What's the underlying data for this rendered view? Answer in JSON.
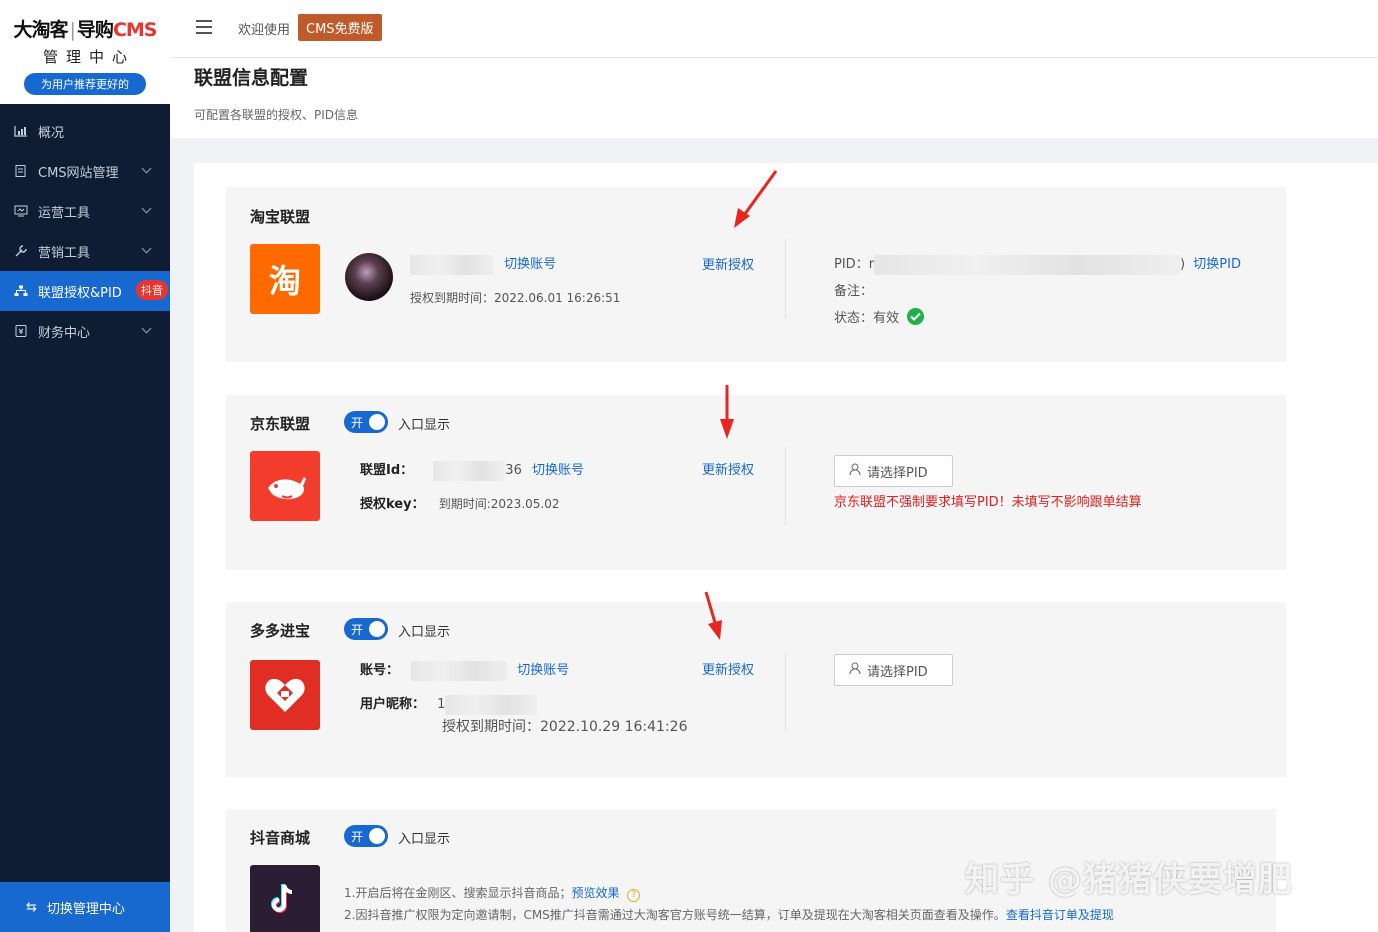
{
  "brand": {
    "logo_part1": "大淘客",
    "logo_sep": "|",
    "logo_part2": "导购",
    "logo_part3": "CMS",
    "subtitle": "管理中心",
    "slogan": "为用户推荐更好的"
  },
  "sidebar": {
    "items": [
      {
        "label": "概况",
        "icon": "bar-chart-icon"
      },
      {
        "label": "CMS网站管理",
        "icon": "document-icon"
      },
      {
        "label": "运营工具",
        "icon": "monitor-icon"
      },
      {
        "label": "营销工具",
        "icon": "wrench-icon"
      },
      {
        "label": "联盟授权&PID",
        "icon": "sitemap-icon",
        "badge": "抖音"
      },
      {
        "label": "财务中心",
        "icon": "finance-icon"
      }
    ],
    "footer_label": "切换管理中心"
  },
  "topbar": {
    "welcome": "欢迎使用",
    "version": "CMS免费版"
  },
  "page": {
    "title": "联盟信息配置",
    "description": "可配置各联盟的授权、PID信息"
  },
  "taobao": {
    "title": "淘宝联盟",
    "logo_char": "淘",
    "switch_account": "切换账号",
    "expire": "授权到期时间：2022.06.01 16:26:51",
    "renew": "更新授权",
    "pid_label": "PID：",
    "pid_visible": "r",
    "pid_tail": ")",
    "switch_pid": "切换PID",
    "remark_label": "备注：",
    "status_label": "状态：有效"
  },
  "jd": {
    "title": "京东联盟",
    "toggle_on": "开",
    "entry_label": "入口显示",
    "union_id_label": "联盟Id：",
    "union_id_tail": "36",
    "switch_account": "切换账号",
    "auth_key_label": "授权key：",
    "expire": "到期时间:2023.05.02",
    "renew": "更新授权",
    "pid_placeholder": "请选择PID",
    "warning": "京东联盟不强制要求填写PID！未填写不影响跟单结算"
  },
  "pdd": {
    "title": "多多进宝",
    "toggle_on": "开",
    "entry_label": "入口显示",
    "account_label": "账号：",
    "switch_account": "切换账号",
    "nickname_label": "用户昵称：",
    "nickname_head": "1",
    "expire": "授权到期时间：2022.10.29 16:41:26",
    "renew": "更新授权",
    "pid_placeholder": "请选择PID"
  },
  "douyin": {
    "title": "抖音商城",
    "toggle_on": "开",
    "entry_label": "入口显示",
    "note1": "1.开启后将在金刚区、搜索显示抖音商品；",
    "note1_link": "预览效果",
    "note2": "2.因抖音推广权限为定向邀请制，CMS推广抖音需通过大淘客官方账号统一结算，订单及提现在大淘客相关页面查看及操作。",
    "note2_link": "查看抖音订单及提现"
  },
  "watermark": "知乎 @猪猪侠要增肥",
  "colors": {
    "sidebar_bg": "#0e1d33",
    "accent": "#1769d0",
    "taobao_orange": "#ff6a00",
    "jd_red": "#f23c2c",
    "pdd_red": "#e02e24",
    "douyin_dark": "#2b1e33",
    "warning_red": "#e02020",
    "annotation_red": "#e8251f"
  }
}
